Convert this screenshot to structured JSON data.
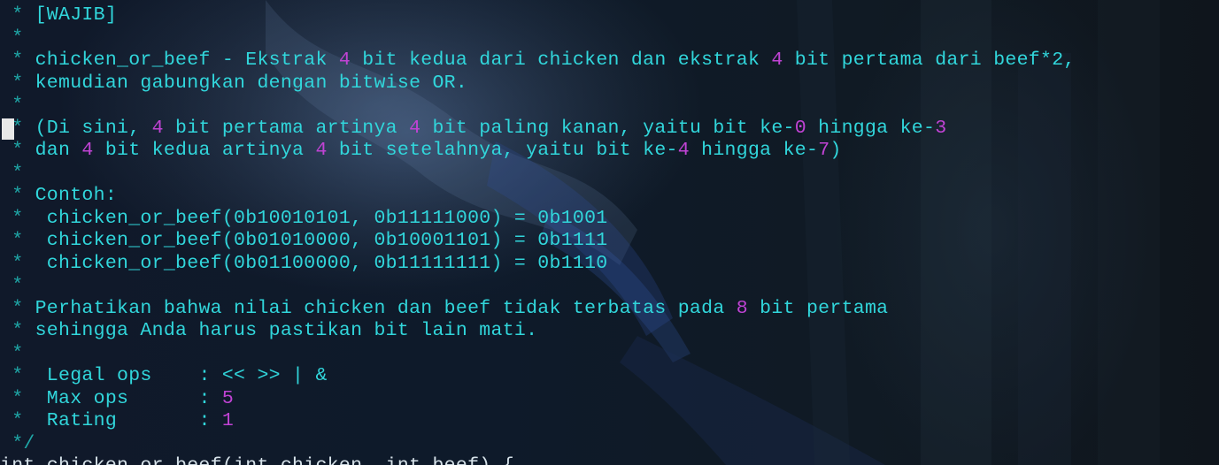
{
  "comment_lines": [
    [
      {
        "t": "[WAJIB]"
      }
    ],
    [],
    [
      {
        "t": "chicken_or_beef - Ekstrak "
      },
      {
        "t": "4",
        "n": 1
      },
      {
        "t": " bit kedua dari chicken dan ekstrak "
      },
      {
        "t": "4",
        "n": 1
      },
      {
        "t": " bit pertama dari beef*2,"
      }
    ],
    [
      {
        "t": "kemudian gabungkan dengan bitwise OR."
      }
    ],
    [],
    [
      {
        "t": "(Di sini, "
      },
      {
        "t": "4",
        "n": 1
      },
      {
        "t": " bit pertama artinya "
      },
      {
        "t": "4",
        "n": 1
      },
      {
        "t": " bit paling kanan, yaitu bit ke-"
      },
      {
        "t": "0",
        "n": 1
      },
      {
        "t": " hingga ke-"
      },
      {
        "t": "3",
        "n": 1
      }
    ],
    [
      {
        "t": "dan "
      },
      {
        "t": "4",
        "n": 1
      },
      {
        "t": " bit kedua artinya "
      },
      {
        "t": "4",
        "n": 1
      },
      {
        "t": " bit setelahnya, yaitu bit ke-"
      },
      {
        "t": "4",
        "n": 1
      },
      {
        "t": " hingga ke-"
      },
      {
        "t": "7",
        "n": 1
      },
      {
        "t": ")"
      }
    ],
    [],
    [
      {
        "t": "Contoh:"
      }
    ],
    [
      {
        "t": " chicken_or_beef(0b10010101, 0b11111000) = 0b1001"
      }
    ],
    [
      {
        "t": " chicken_or_beef(0b01010000, 0b10001101) = 0b1111"
      }
    ],
    [
      {
        "t": " chicken_or_beef(0b01100000, 0b11111111) = 0b1110"
      }
    ],
    [],
    [
      {
        "t": "Perhatikan bahwa nilai chicken dan beef tidak terbatas pada "
      },
      {
        "t": "8",
        "n": 1
      },
      {
        "t": " bit pertama"
      }
    ],
    [
      {
        "t": "sehingga Anda harus pastikan bit lain mati."
      }
    ],
    [],
    [
      {
        "t": " Legal ops    : << >> | &"
      }
    ],
    [
      {
        "t": " Max ops      : "
      },
      {
        "t": "5",
        "n": 1
      }
    ],
    [
      {
        "t": " Rating       : "
      },
      {
        "t": "1",
        "n": 1
      }
    ]
  ],
  "gutter_star": "*",
  "closing_line": "*/",
  "last_line": "int chicken_or_beef(int chicken, int beef) {",
  "colors": {
    "text": "#31d6db",
    "gutter": "#1fa8a8",
    "number": "#c043d4",
    "cursor": "#e8e8e8"
  }
}
